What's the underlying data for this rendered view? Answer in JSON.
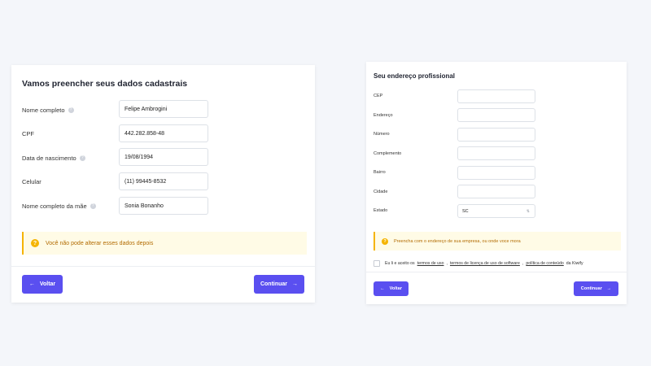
{
  "left_form": {
    "title": "Vamos preencher seus dados cadastrais",
    "fields": [
      {
        "label": "Nome completo",
        "value": "Felipe Ambrogini",
        "help": true
      },
      {
        "label": "CPF",
        "value": "442.282.858-48",
        "help": false
      },
      {
        "label": "Data de nascimento",
        "value": "19/08/1994",
        "help": true
      },
      {
        "label": "Celular",
        "value": "(11) 99445-8532",
        "help": false
      },
      {
        "label": "Nome completo da mãe",
        "value": "Sonia Bonanho",
        "help": true
      }
    ],
    "alert": "Você não pode alterar esses dados depois",
    "back_label": "Voltar",
    "continue_label": "Continuar",
    "back_icon": "arrow-left-icon",
    "continue_icon": "arrow-right-icon"
  },
  "right_form": {
    "title": "Seu endereço profissional",
    "fields": [
      {
        "label": "CEP",
        "value": ""
      },
      {
        "label": "Endereço",
        "value": ""
      },
      {
        "label": "Número",
        "value": ""
      },
      {
        "label": "Complemento",
        "value": ""
      },
      {
        "label": "Bairro",
        "value": ""
      },
      {
        "label": "Cidade",
        "value": ""
      },
      {
        "label": "Estado",
        "value": "SC"
      }
    ],
    "alert": "Preencha com o endereço de sua empresa, ou onde voce mora",
    "terms": {
      "prefix": "Eu li e aceito os",
      "link1": "termos de uso",
      "sep1": ",",
      "link2": "termos de licença de uso de software",
      "sep2": ",",
      "link3": "política de conteúdo",
      "suffix": "da Kiwify"
    },
    "back_label": "Voltar",
    "continue_label": "Continuar"
  },
  "colors": {
    "primary": "#5a4ff0",
    "alert_bg": "#fffbe6",
    "alert_border": "#f5b400",
    "alert_text": "#b26b00"
  }
}
